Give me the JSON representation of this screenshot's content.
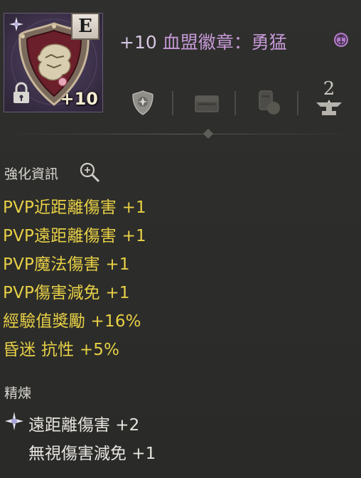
{
  "item": {
    "grade": "E",
    "level_badge": "+10",
    "enhance_prefix": "+10",
    "name": "血盟徽章：勇猛"
  },
  "slots": {
    "count_label": "2"
  },
  "sections": {
    "enhance_title": "強化資訊",
    "refine_title": "精煉"
  },
  "enhance_stats": [
    "PVP近距離傷害 +1",
    "PVP遠距離傷害 +1",
    "PVP魔法傷害 +1",
    "PVP傷害減免 +1",
    "經驗值獎勵 +16%",
    "昏迷 抗性 +5%"
  ],
  "refine_stats": [
    "遠距離傷害 +2",
    "無視傷害減免 +1"
  ],
  "colors": {
    "stat_yellow": "#e7d046",
    "title_purple": "#c79ad8",
    "background": "#2b2b2a"
  },
  "icons": [
    "emblem-shield-icon",
    "lock-icon",
    "sparkle-icon",
    "rune-icon",
    "shield-slot-icon",
    "chest-slot-icon",
    "potion-slot-icon",
    "anvil-slot-icon",
    "magnify-icon",
    "refine-star-icon"
  ]
}
